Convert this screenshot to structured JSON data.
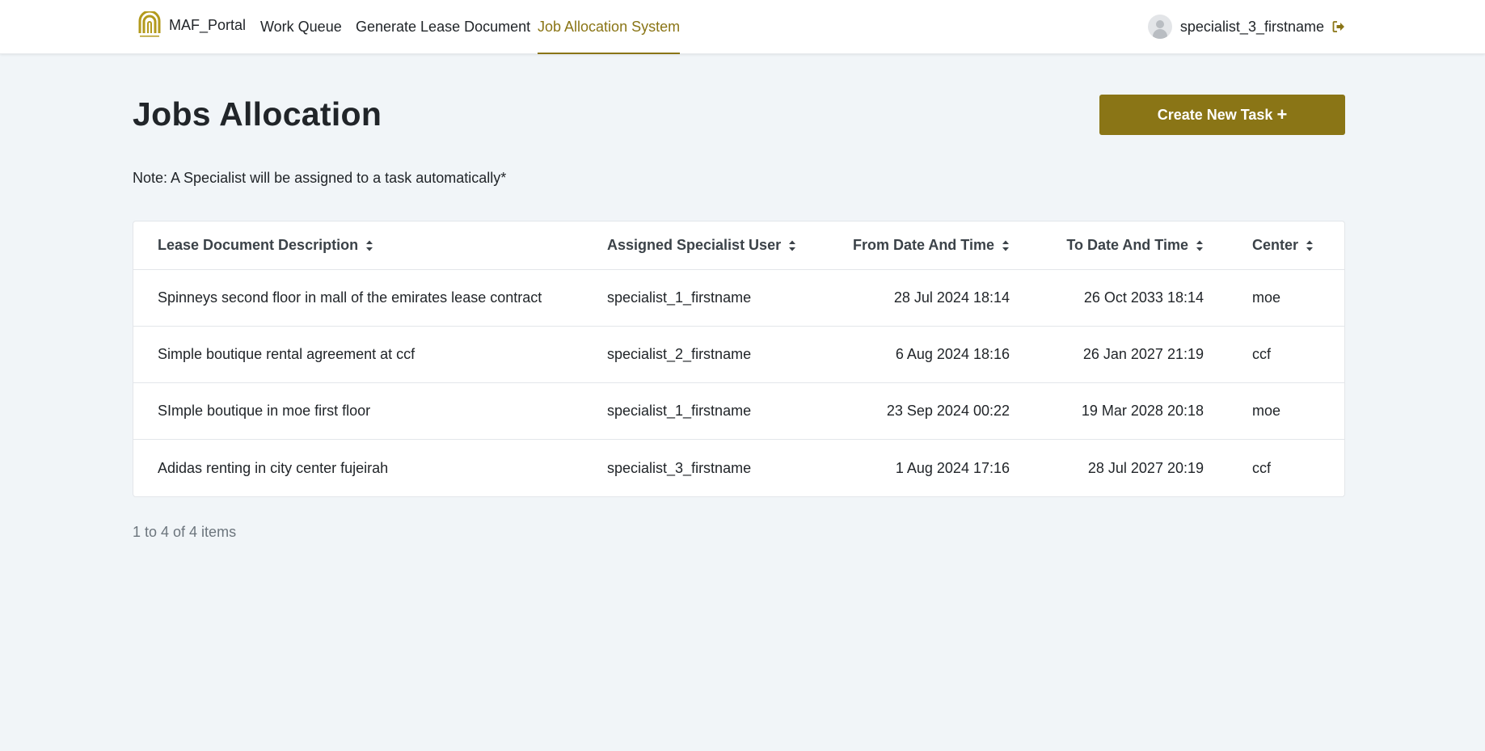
{
  "nav": {
    "brand_label": "MAF_Portal",
    "links": [
      {
        "label": "Work Queue"
      },
      {
        "label": "Generate Lease Document"
      },
      {
        "label": "Job Allocation System"
      }
    ],
    "user_name": "specialist_3_firstname"
  },
  "page": {
    "title": "Jobs Allocation",
    "create_button_label": "Create New Task",
    "note": "Note: A Specialist will be assigned to a task automatically*"
  },
  "table": {
    "columns": [
      "Lease Document Description",
      "Assigned Specialist User",
      "From Date And Time",
      "To Date And Time",
      "Center"
    ],
    "rows": [
      [
        "Spinneys second floor in mall of the emirates lease contract",
        "specialist_1_firstname",
        "28 Jul 2024 18:14",
        "26 Oct 2033 18:14",
        "moe"
      ],
      [
        "Simple boutique rental agreement at ccf",
        "specialist_2_firstname",
        "6 Aug 2024 18:16",
        "26 Jan 2027 21:19",
        "ccf"
      ],
      [
        "SImple boutique in moe first floor",
        "specialist_1_firstname",
        "23 Sep 2024 00:22",
        "19 Mar 2028 20:18",
        "moe"
      ],
      [
        "Adidas renting in city center fujeirah",
        "specialist_3_firstname",
        "1 Aug 2024 17:16",
        "28 Jul 2027 20:19",
        "ccf"
      ]
    ]
  },
  "pagination": {
    "summary": "1 to 4 of 4 items"
  },
  "colors": {
    "accent": "#8a7516",
    "background": "#f1f5f8"
  }
}
